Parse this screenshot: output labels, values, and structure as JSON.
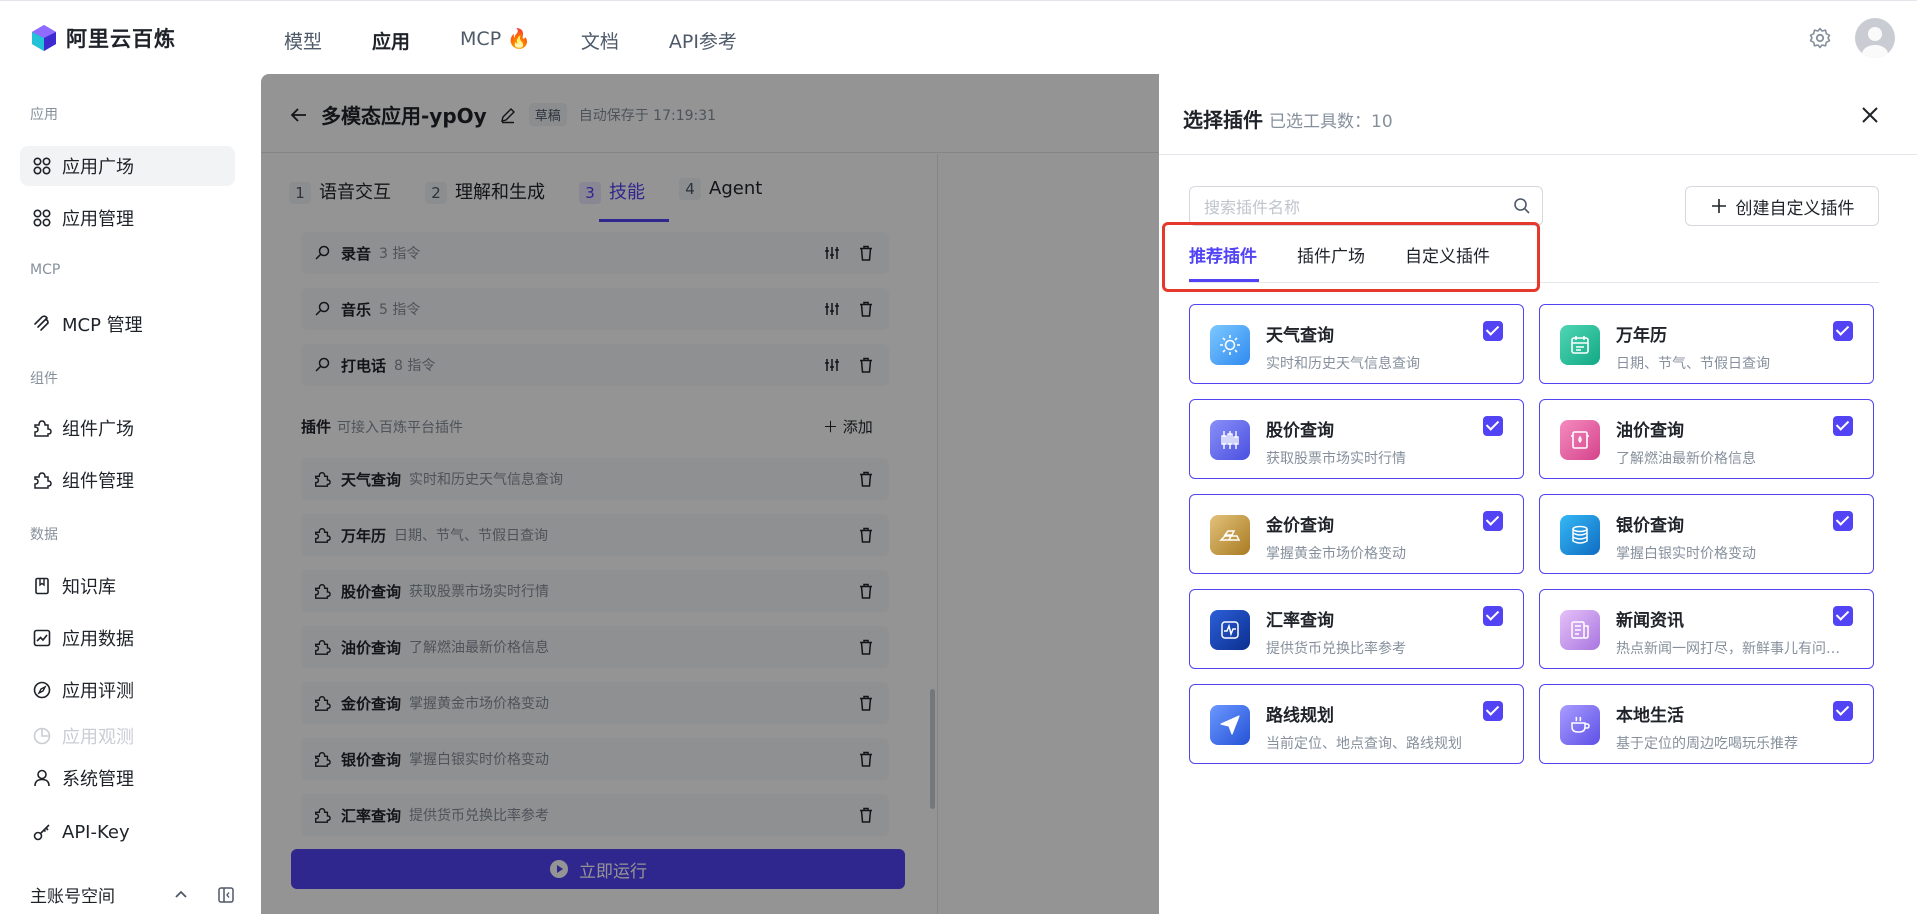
{
  "brand": {
    "name": "阿里云百炼"
  },
  "topnav": {
    "items": [
      "模型",
      "应用",
      "MCP 🔥",
      "文档",
      "API参考"
    ],
    "active_index": 1
  },
  "sidebar": {
    "sections": {
      "app": "应用",
      "mcp": "MCP",
      "component": "组件",
      "data": "数据"
    },
    "items": [
      {
        "label": "应用广场",
        "icon": "grid-icon",
        "active": true
      },
      {
        "label": "应用管理",
        "icon": "grid-icon"
      },
      {
        "label": "MCP 管理",
        "icon": "mcp-icon"
      },
      {
        "label": "组件广场",
        "icon": "puzzle-icon"
      },
      {
        "label": "组件管理",
        "icon": "puzzle-icon"
      },
      {
        "label": "知识库",
        "icon": "book-icon"
      },
      {
        "label": "应用数据",
        "icon": "chart-icon"
      },
      {
        "label": "应用评测",
        "icon": "compass-icon"
      },
      {
        "label": "应用观测",
        "icon": "pie-icon"
      },
      {
        "label": "系统管理",
        "icon": "user-icon"
      },
      {
        "label": "API-Key",
        "icon": "key-icon"
      }
    ],
    "workspace_label": "主账号空间"
  },
  "workspace": {
    "title": "多模态应用-ypOy",
    "draft": "草稿",
    "autosave": "自动保存于 17:19:31",
    "steps": [
      {
        "n": "1",
        "label": "语音交互"
      },
      {
        "n": "2",
        "label": "理解和生成"
      },
      {
        "n": "3",
        "label": "技能"
      },
      {
        "n": "4",
        "label": "Agent"
      }
    ],
    "skills": [
      {
        "title": "录音",
        "desc": "3 指令"
      },
      {
        "title": "音乐",
        "desc": "5 指令"
      },
      {
        "title": "打电话",
        "desc": "8 指令"
      }
    ],
    "plugin_header": {
      "title": "插件",
      "desc": "可接入百炼平台插件",
      "add": "添加"
    },
    "plugins": [
      {
        "title": "天气查询",
        "desc": "实时和历史天气信息查询"
      },
      {
        "title": "万年历",
        "desc": "日期、节气、节假日查询"
      },
      {
        "title": "股价查询",
        "desc": "获取股票市场实时行情"
      },
      {
        "title": "油价查询",
        "desc": "了解燃油最新价格信息"
      },
      {
        "title": "金价查询",
        "desc": "掌握黄金市场价格变动"
      },
      {
        "title": "银价查询",
        "desc": "掌握白银实时价格变动"
      },
      {
        "title": "汇率查询",
        "desc": "提供货币兑换比率参考"
      }
    ],
    "run_button": "立即运行"
  },
  "panel": {
    "title": "选择插件",
    "count": "已选工具数：10",
    "search_placeholder": "搜索插件名称",
    "create_button": "创建自定义插件",
    "tabs": [
      "推荐插件",
      "插件广场",
      "自定义插件"
    ],
    "cards": [
      {
        "title": "天气查询",
        "desc": "实时和历史天气信息查询",
        "color": "#3aa3ff",
        "checked": true
      },
      {
        "title": "万年历",
        "desc": "日期、节气、节假日查询",
        "color": "#19b394",
        "checked": true
      },
      {
        "title": "股价查询",
        "desc": "获取股票市场实时行情",
        "color": "#5a63f0",
        "checked": true
      },
      {
        "title": "油价查询",
        "desc": "了解燃油最新价格信息",
        "color": "#e2589b",
        "checked": true
      },
      {
        "title": "金价查询",
        "desc": "掌握黄金市场价格变动",
        "color": "#c69a3c",
        "checked": true
      },
      {
        "title": "银价查询",
        "desc": "掌握白银实时价格变动",
        "color": "#1b8ad9",
        "checked": true
      },
      {
        "title": "汇率查询",
        "desc": "提供货币兑换比率参考",
        "color": "#1547b8",
        "checked": true
      },
      {
        "title": "新闻资讯",
        "desc": "热点新闻一网打尽，新鲜事儿有问必答",
        "color": "#c08de8",
        "checked": true
      },
      {
        "title": "路线规划",
        "desc": "当前定位、地点查询、路线规划",
        "color": "#3b6df2",
        "checked": true
      },
      {
        "title": "本地生活",
        "desc": "基于定位的周边吃喝玩乐推荐",
        "color": "#7b72f0",
        "checked": true
      }
    ]
  },
  "colors": {
    "accent": "#5243f5",
    "highlight": "#e4392c"
  }
}
